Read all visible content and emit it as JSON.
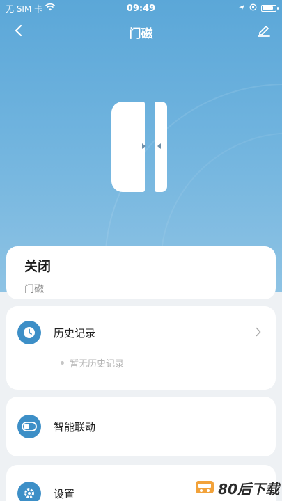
{
  "status_bar": {
    "carrier": "无 SIM 卡",
    "time": "09:49"
  },
  "nav": {
    "title": "门磁"
  },
  "device_state": {
    "value": "关闭",
    "name": "门磁"
  },
  "history": {
    "label": "历史记录",
    "empty_text": "暂无历史记录"
  },
  "linkage": {
    "label": "智能联动"
  },
  "settings": {
    "label": "设置"
  },
  "watermark": {
    "text": "80后下载"
  },
  "colors": {
    "accent": "#3d8fc7",
    "hero_top": "#5ba7d8",
    "hero_bottom": "#8ec3e4"
  },
  "icons": {
    "back": "chevron-left-icon",
    "edit": "pencil-icon",
    "history": "clock-icon",
    "linkage": "toggle-icon",
    "settings": "gear-icon"
  }
}
